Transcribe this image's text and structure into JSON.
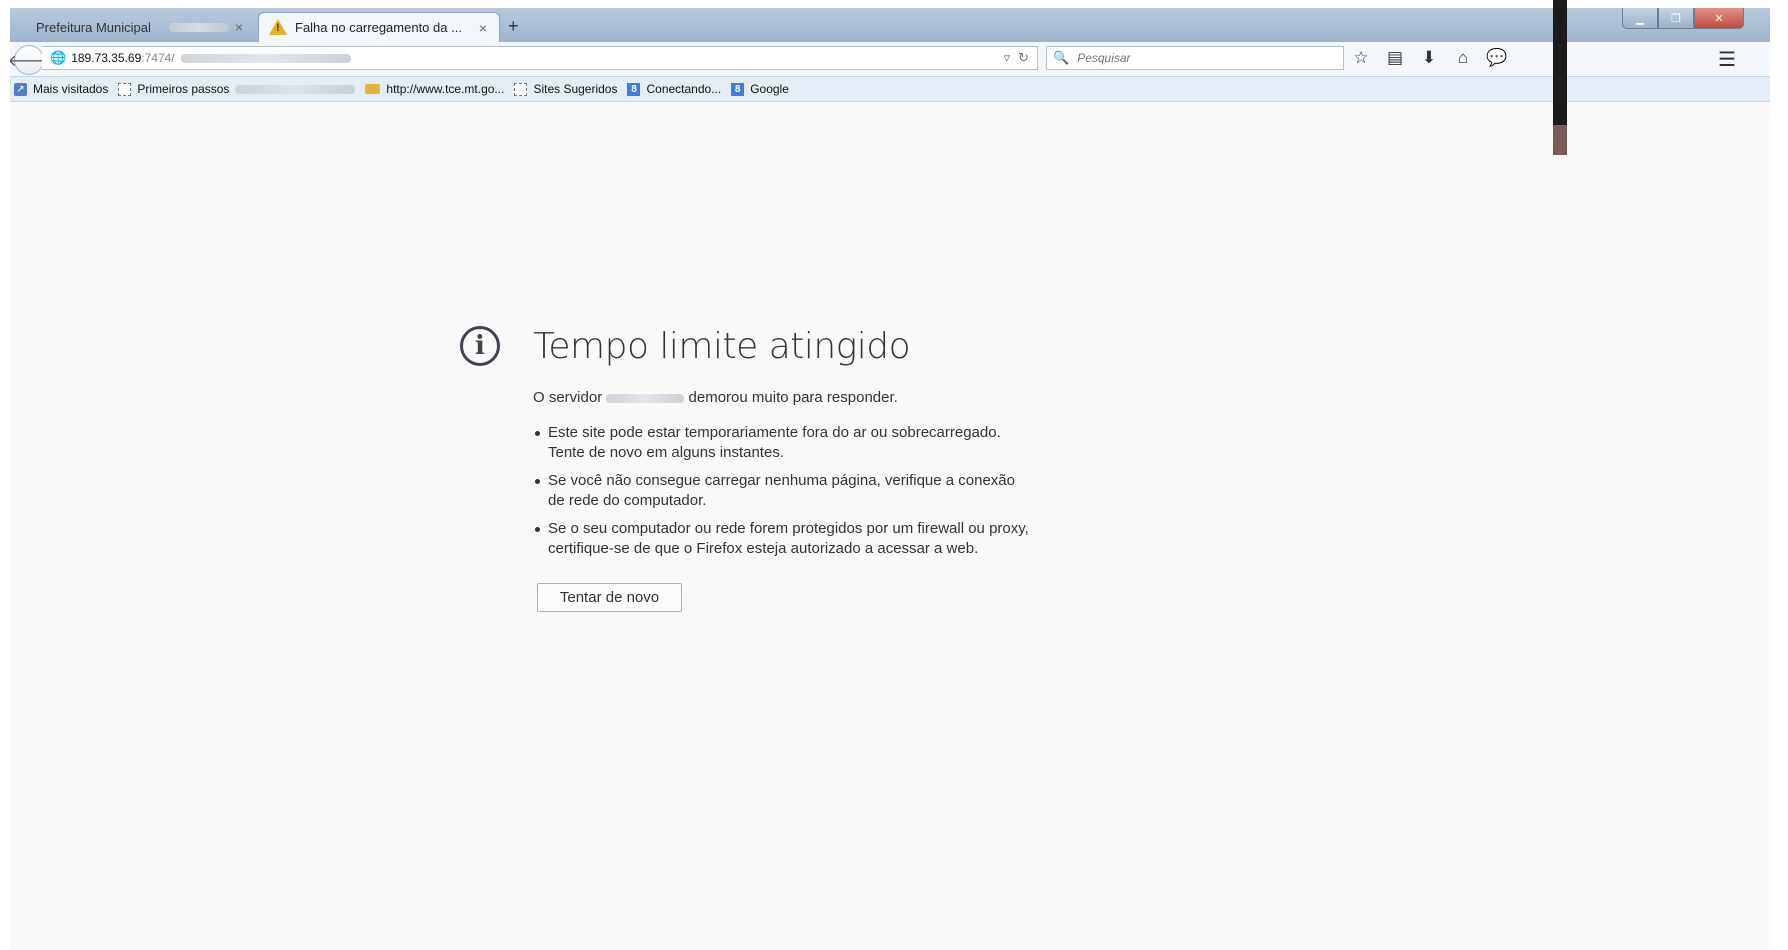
{
  "tabs": [
    {
      "title": "Prefeitura Municipal",
      "active": false
    },
    {
      "title": "Falha no carregamento da ...",
      "active": true
    }
  ],
  "tab_close_glyph": "×",
  "new_tab_glyph": "+",
  "url": {
    "host": "189.73.35.69",
    "port": ":7474/"
  },
  "search": {
    "placeholder": "Pesquisar"
  },
  "toolbar_icons": [
    "star-icon",
    "reading-list-icon",
    "download-icon",
    "home-icon",
    "chat-icon",
    "menu-icon"
  ],
  "bookmarks": [
    {
      "label": "Mais visitados",
      "icon": "most-visited-icon"
    },
    {
      "label": "Primeiros passos",
      "icon": "page-icon"
    },
    {
      "label": "http://www.tce.mt.go...",
      "icon": "folder-icon"
    },
    {
      "label": "Sites Sugeridos",
      "icon": "page-icon"
    },
    {
      "label": "Conectando...",
      "icon": "g8-icon"
    },
    {
      "label": "Google",
      "icon": "g8-icon"
    }
  ],
  "error": {
    "title": "Tempo limite atingido",
    "desc_prefix": "O servidor",
    "desc_suffix": "demorou muito para responder.",
    "items": [
      "Este site pode estar temporariamente fora do ar ou sobrecarregado. Tente de novo em alguns instantes.",
      "Se você não consegue carregar nenhuma página, verifique a conexão de rede do computador.",
      "Se o seu computador ou rede forem protegidos por um firewall ou proxy, certifique-se de que o Firefox esteja autorizado a acessar a web."
    ],
    "retry_label": "Tentar de novo"
  },
  "colors": {
    "titlebar": "#a9bdd4",
    "page_bg": "#f9f9f9",
    "text": "#333333",
    "warning": "#e6b422"
  }
}
